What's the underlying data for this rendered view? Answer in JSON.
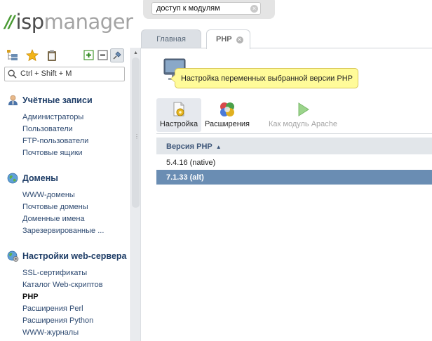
{
  "header": {
    "logo_prefix": "isp",
    "logo_suffix": "manager",
    "search_value": "доступ к модулям"
  },
  "tabs": [
    {
      "label": "Главная"
    },
    {
      "label": "PHP"
    }
  ],
  "sidebar": {
    "search_placeholder": "Ctrl + Shift + M",
    "sections": [
      {
        "title": "Учётные записи",
        "icon": "user-icon",
        "items": [
          "Администраторы",
          "Пользователи",
          "FTP-пользователи",
          "Почтовые ящики"
        ]
      },
      {
        "title": "Домены",
        "icon": "globe-icon",
        "items": [
          "WWW-домены",
          "Почтовые домены",
          "Доменные имена",
          "Зарезервированные ..."
        ]
      },
      {
        "title": "Настройки web-сервера",
        "icon": "globe-gear-icon",
        "items": [
          "SSL-сертификаты",
          "Каталог Web-скриптов",
          "PHP",
          "Расширения Perl",
          "Расширения Python",
          "WWW-журналы"
        ]
      }
    ]
  },
  "content": {
    "tooltip": "Настройка переменных выбранной версии PHP",
    "toolbar": {
      "settings": "Настройка",
      "extensions": "Расширения",
      "apache_module": "Как модуль Apache"
    },
    "grid": {
      "column": "Версия PHP",
      "rows": [
        "5.4.16 (native)",
        "7.1.33 (alt)"
      ]
    }
  },
  "colors": {
    "logo_green": "#4a9a34",
    "selected_row": "#6a8db3",
    "section_title": "#1d3c66",
    "link": "#2f4b72",
    "tooltip_bg": "#fffb99"
  }
}
